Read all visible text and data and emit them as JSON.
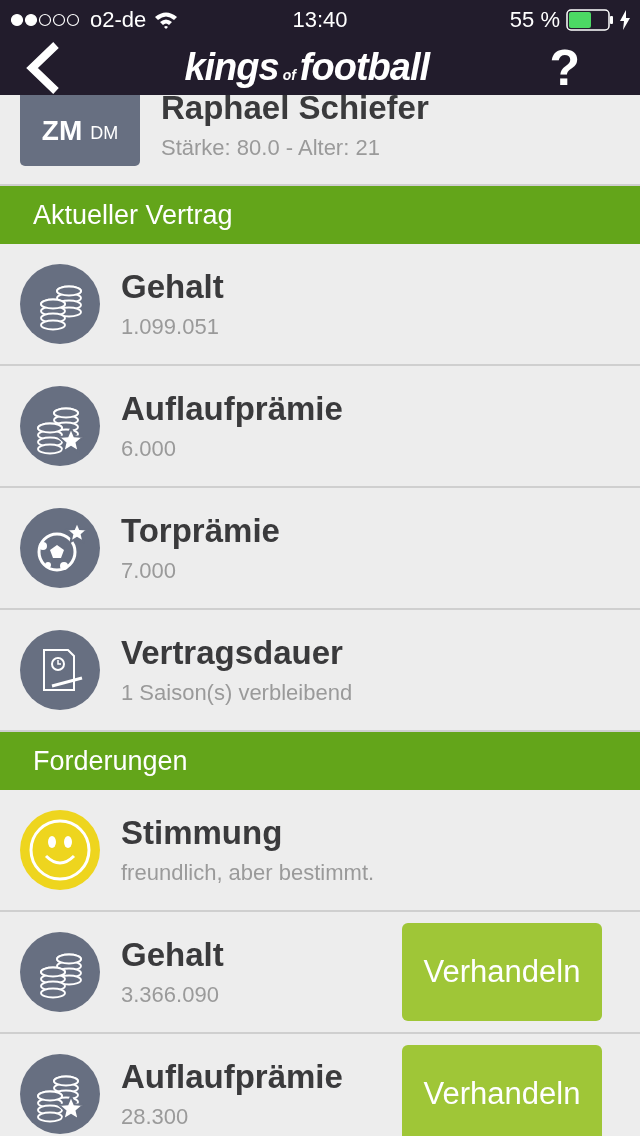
{
  "status_bar": {
    "carrier": "o2-de",
    "time": "13:40",
    "battery": "55 %",
    "charging": true
  },
  "nav": {
    "logo": [
      "kings",
      "of",
      "football"
    ],
    "help": "?"
  },
  "player": {
    "position": "ZM",
    "secondary_position": "DM",
    "name": "Raphael Schiefer",
    "details": "Stärke: 80.0 - Alter: 21"
  },
  "sections": [
    {
      "title": "Aktueller Vertrag",
      "rows": [
        {
          "kind": "coins",
          "title": "Gehalt",
          "value": "1.099.051"
        },
        {
          "kind": "coins-star",
          "title": "Auflaufprämie",
          "value": "6.000"
        },
        {
          "kind": "ball-star",
          "title": "Torprämie",
          "value": "7.000"
        },
        {
          "kind": "contract",
          "title": "Vertragsdauer",
          "value": "1 Saison(s) verbleibend"
        }
      ]
    },
    {
      "title": "Forderungen",
      "rows": [
        {
          "kind": "smiley",
          "title": "Stimmung",
          "value": "freundlich, aber bestimmt."
        },
        {
          "kind": "coins",
          "title": "Gehalt",
          "value": "3.366.090",
          "button": "Verhandeln"
        },
        {
          "kind": "coins-star",
          "title": "Auflaufprämie",
          "value": "28.300",
          "button": "Verhandeln"
        }
      ]
    }
  ]
}
